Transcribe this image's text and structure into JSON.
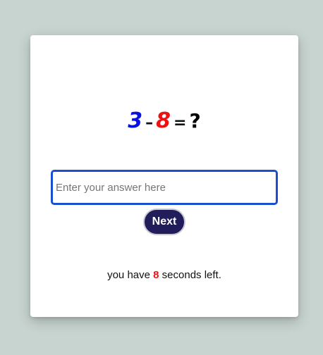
{
  "quiz": {
    "operand_a": "3",
    "operator": "–",
    "operand_b": "8",
    "equals": "=",
    "unknown": "?",
    "colors": {
      "operand_a": "#0a12e0",
      "operand_b": "#ee1111",
      "operator": "#111111",
      "unknown": "#000000"
    }
  },
  "answer": {
    "value": "",
    "placeholder": "Enter your answer here"
  },
  "next_button": {
    "label": "Next",
    "background": "#211d5a"
  },
  "timer": {
    "prefix": "you have",
    "seconds": "8",
    "suffix": "seconds left."
  }
}
